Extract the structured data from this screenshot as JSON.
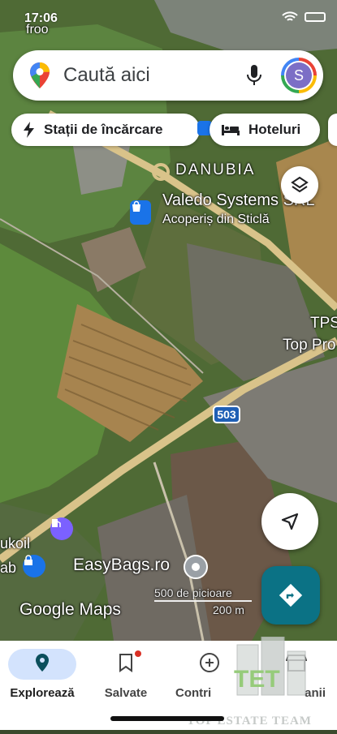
{
  "status_bar": {
    "time": "17:06"
  },
  "search": {
    "placeholder": "Caută aici",
    "avatar_letter": "S"
  },
  "chips": [
    {
      "label": "Stații de încărcare",
      "icon": "bolt-icon"
    },
    {
      "label": "Hoteluri",
      "icon": "bed-icon"
    }
  ],
  "map_labels": {
    "froo_top": "froo",
    "danubia": "DANUBIA",
    "valedo": "Valedo Systems SRL",
    "acoperis": "Acoperiș din Sticlă",
    "tps": "TPS",
    "top_pro": "Top Pro",
    "route": "503",
    "lukoil": "ukoil",
    "lab": "ab",
    "easybags": "EasyBags.ro",
    "google_maps": "Google Maps"
  },
  "scale": {
    "feet": "500 de picioare",
    "meters": "200 m"
  },
  "nav": [
    {
      "label": "Explorează",
      "icon": "location-pin-icon",
      "active": true
    },
    {
      "label": "Salvate",
      "icon": "bookmark-icon",
      "active": false
    },
    {
      "label": "Contri",
      "icon": "add-circle-icon",
      "active": false
    },
    {
      "label": "anii",
      "icon": "store-icon",
      "active": false
    }
  ],
  "watermark": {
    "text": "TOP ESTATE TEAM",
    "logo": "TET"
  },
  "colors": {
    "accent_blue": "#1a73e8",
    "directions_teal": "#0b7285",
    "fab_white": "#ffffff",
    "nav_active_bg": "#d3e3fd"
  }
}
